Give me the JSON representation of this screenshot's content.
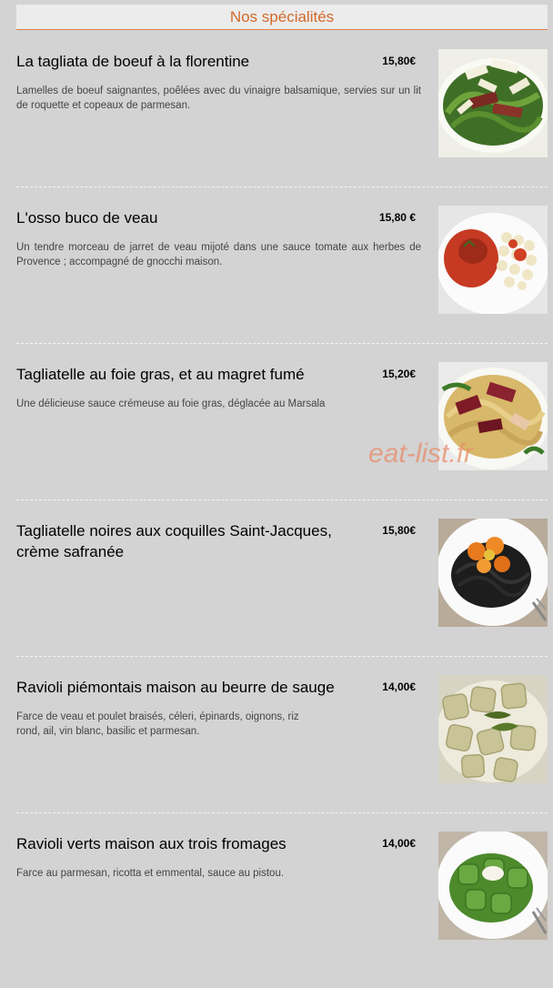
{
  "header": {
    "title": "Nos spécialités"
  },
  "watermark": "eat-list.fr",
  "items": [
    {
      "title": "La tagliata de boeuf à la florentine",
      "price": "15,80€",
      "description": "Lamelles de boeuf saignantes, poêlées avec du vinaigre balsamique, servies sur un lit de roquette et copeaux de parmesan."
    },
    {
      "title": "L'osso buco de veau",
      "price": "15,80 €",
      "description": "Un tendre morceau de jarret de veau mijoté dans une sauce tomate aux herbes de Provence ; accompagné de gnocchi maison."
    },
    {
      "title": "Tagliatelle au foie gras, et au magret fumé",
      "price": "15,20€",
      "description": "Une délicieuse sauce crémeuse au foie gras, déglacée au Marsala"
    },
    {
      "title": "Tagliatelle noires aux coquilles Saint-Jacques, crème safranée",
      "price": "15,80€",
      "description": ""
    },
    {
      "title": "Ravioli piémontais maison au beurre de sauge",
      "price": "14,00€",
      "description": "Farce de veau et poulet braisés, céleri, épinards, oignons, riz rond, ail, vin blanc, basilic et parmesan."
    },
    {
      "title": "Ravioli verts maison aux trois fromages",
      "price": "14,00€",
      "description": "Farce au parmesan, ricotta et emmental, sauce au pistou."
    }
  ]
}
